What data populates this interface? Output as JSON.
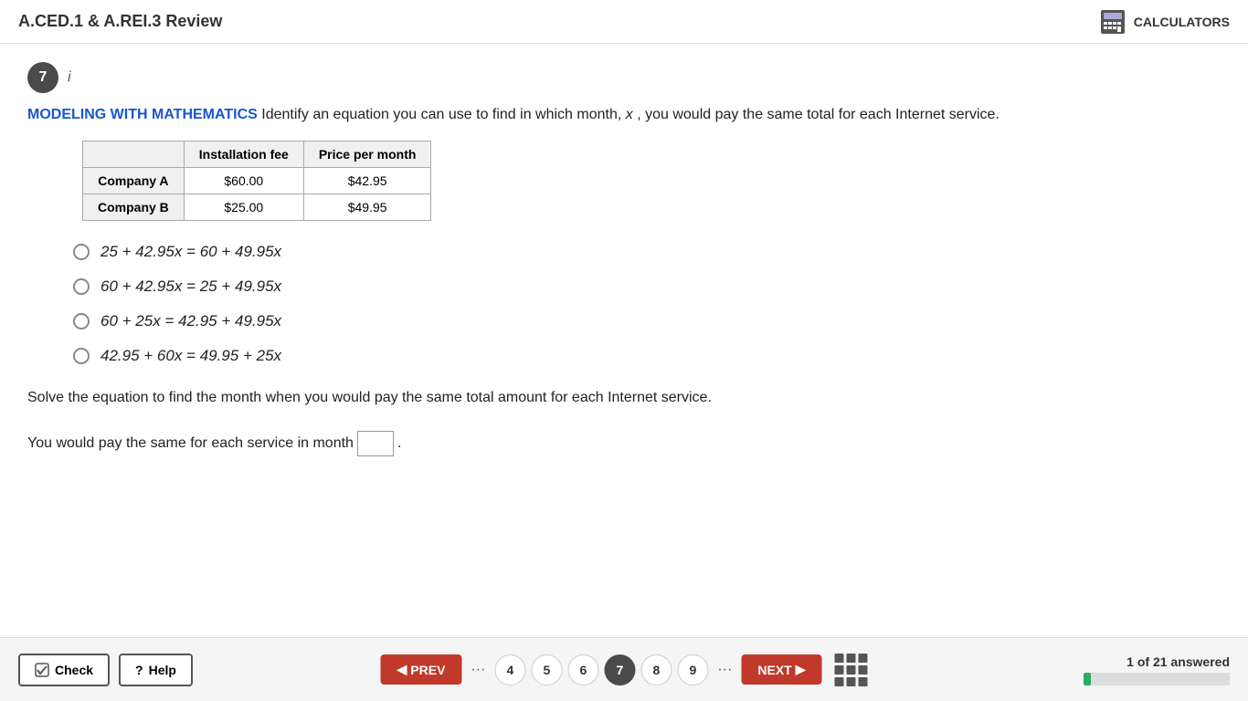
{
  "header": {
    "title": "A.CED.1 & A.REI.3 Review",
    "calculators_label": "CALCULATORS"
  },
  "question": {
    "number": "7",
    "info_label": "i",
    "modeling_label": "MODELING WITH MATHEMATICS",
    "question_text": "Identify an equation you can use to find in which month,",
    "variable": "x",
    "question_text2": ", you would pay the same total for each Internet service."
  },
  "table": {
    "headers": [
      "Installation fee",
      "Price per month"
    ],
    "rows": [
      {
        "company": "Company A",
        "fee": "$60.00",
        "price": "$42.95"
      },
      {
        "company": "Company B",
        "fee": "$25.00",
        "price": "$49.95"
      }
    ]
  },
  "choices": [
    {
      "id": "a",
      "text": "25 + 42.95x = 60 + 49.95x"
    },
    {
      "id": "b",
      "text": "60 + 42.95x = 25 + 49.95x"
    },
    {
      "id": "c",
      "text": "60 + 25x = 42.95 + 49.95x"
    },
    {
      "id": "d",
      "text": "42.95 + 60x = 49.95 + 25x"
    }
  ],
  "solve_text": "Solve the equation to find the month when you would pay the same total amount for each Internet service.",
  "answer_prefix": "You would pay the same for each service in month",
  "answer_suffix": ".",
  "footer": {
    "check_label": "Check",
    "help_label": "Help",
    "prev_label": "PREV",
    "next_label": "NEXT",
    "pages": [
      "4",
      "5",
      "6",
      "7",
      "8",
      "9"
    ],
    "active_page": "7",
    "answered_text": "1 of 21 answered",
    "progress_percent": 5
  }
}
